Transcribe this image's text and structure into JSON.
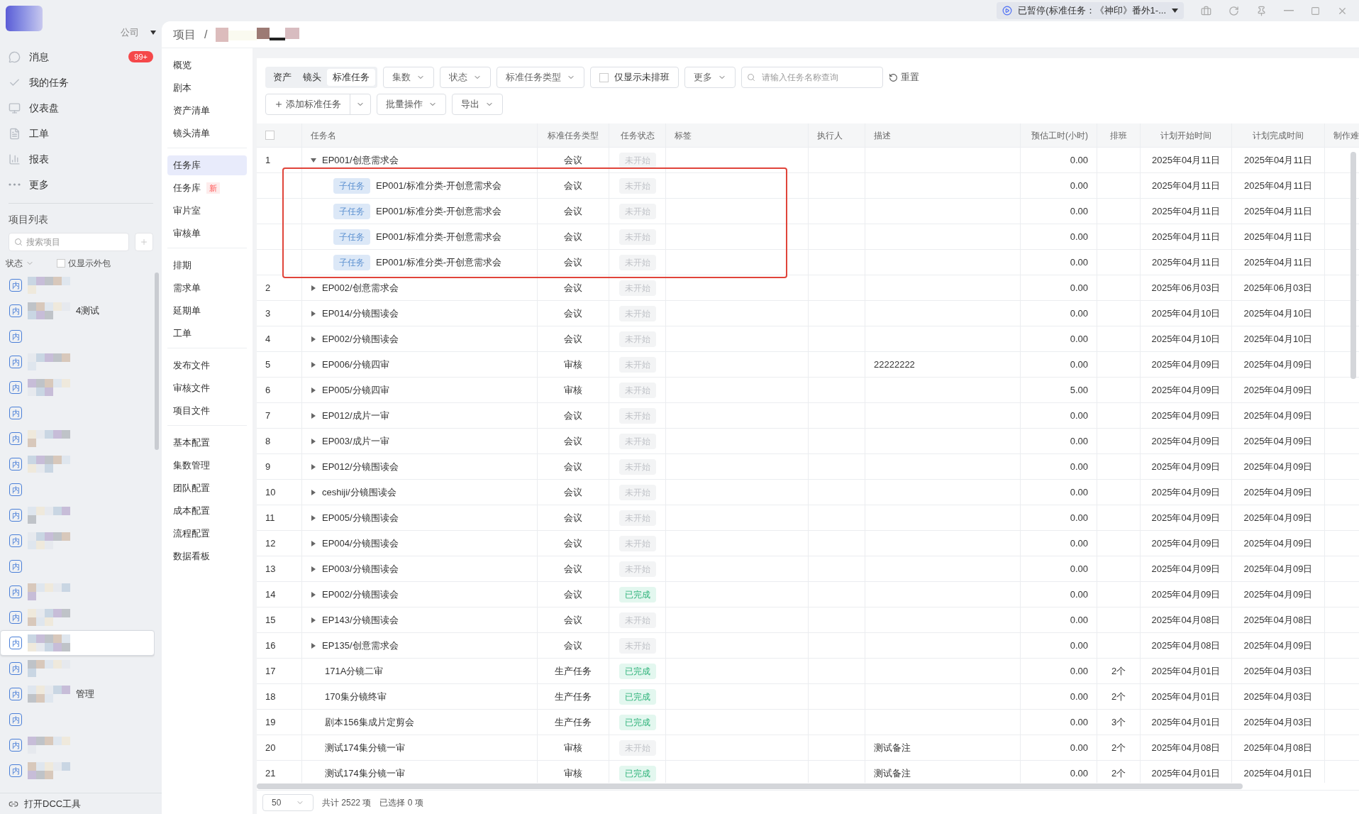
{
  "titlebar": {
    "task_status": "已暂停(标准任务：《神印》番外1-..."
  },
  "company": "公司",
  "nav": [
    {
      "label": "消息",
      "badge": "99+"
    },
    {
      "label": "我的任务"
    },
    {
      "label": "仪表盘"
    },
    {
      "label": "工单"
    },
    {
      "label": "报表"
    },
    {
      "label": "更多"
    }
  ],
  "project_list": {
    "title": "项目列表",
    "search_placeholder": "搜索项目",
    "filter": "状态",
    "outsourced_only": {
      "label": "仅显示外包",
      "checked": false
    },
    "items": [
      {
        "badge": "内",
        "selected": false
      },
      {
        "badge": "内",
        "name": "4测试",
        "selected": false
      },
      {
        "badge": "内",
        "selected": false
      },
      {
        "badge": "内",
        "selected": false
      },
      {
        "badge": "内",
        "selected": false
      },
      {
        "badge": "内",
        "selected": false
      },
      {
        "badge": "内",
        "selected": false
      },
      {
        "badge": "内",
        "selected": false
      },
      {
        "badge": "内",
        "selected": false
      },
      {
        "badge": "内",
        "selected": false
      },
      {
        "badge": "内",
        "selected": false
      },
      {
        "badge": "内",
        "selected": false
      },
      {
        "badge": "内",
        "selected": false
      },
      {
        "badge": "内",
        "selected": false
      },
      {
        "badge": "内",
        "selected": true
      },
      {
        "badge": "内",
        "selected": false
      },
      {
        "badge": "内",
        "name": "管理",
        "selected": false
      },
      {
        "badge": "内",
        "selected": false
      },
      {
        "badge": "内",
        "selected": false
      },
      {
        "badge": "内",
        "selected": false
      }
    ]
  },
  "dcc_tool": "打开DCC工具",
  "breadcrumb": {
    "root": "项目",
    "separator": "/"
  },
  "subnav": [
    [
      {
        "label": "概览",
        "selected": false
      },
      {
        "label": "剧本",
        "selected": false
      },
      {
        "label": "资产清单",
        "selected": false
      },
      {
        "label": "镜头清单",
        "selected": false
      }
    ],
    [
      {
        "label": "任务库",
        "selected": true
      },
      {
        "label": "任务库",
        "badge": "新",
        "selected": false
      },
      {
        "label": "审片室",
        "selected": false
      },
      {
        "label": "审核单",
        "selected": false
      }
    ],
    [
      {
        "label": "排期",
        "selected": false
      },
      {
        "label": "需求单",
        "selected": false
      },
      {
        "label": "延期单",
        "selected": false
      },
      {
        "label": "工单",
        "selected": false
      }
    ],
    [
      {
        "label": "发布文件",
        "selected": false
      },
      {
        "label": "审核文件",
        "selected": false
      },
      {
        "label": "项目文件",
        "selected": false
      }
    ],
    [
      {
        "label": "基本配置",
        "selected": false
      },
      {
        "label": "集数管理",
        "selected": false
      },
      {
        "label": "团队配置",
        "selected": false
      },
      {
        "label": "成本配置",
        "selected": false
      },
      {
        "label": "流程配置",
        "selected": false
      },
      {
        "label": "数据看板",
        "selected": false
      }
    ]
  ],
  "view_tabs": [
    {
      "label": "资产",
      "selected": false
    },
    {
      "label": "镜头",
      "selected": false
    },
    {
      "label": "标准任务",
      "selected": true
    }
  ],
  "filters": [
    "集数",
    "状态",
    "标准任务类型"
  ],
  "unscheduled_only": {
    "label": "仅显示未排班",
    "checked": false
  },
  "more": "更多",
  "search": {
    "placeholder": "请输入任务名称查询"
  },
  "reset": "重置",
  "actions": {
    "add": "添加标准任务",
    "batch": "批量操作",
    "export": "导出"
  },
  "table": {
    "all_selected": false,
    "columns": [
      "任务名",
      "标准任务类型",
      "任务状态",
      "标签",
      "执行人",
      "描述",
      "预估工时(小时)",
      "排班",
      "计划开始时间",
      "计划完成时间",
      "制作难"
    ],
    "rows": [
      {
        "index": "1",
        "name": "EP001/创意需求会",
        "expandable": true,
        "expanded": true,
        "children_framed": true,
        "type": "会议",
        "status": "未开始",
        "completed": false,
        "hours": "0.00",
        "start": "2025年04月11日",
        "end": "2025年04月11日",
        "children": [
          {
            "tag": "子任务",
            "name": "EP001/标准分类-开创意需求会",
            "type": "会议",
            "status": "未开始",
            "completed": false,
            "hours": "0.00",
            "start": "2025年04月11日",
            "end": "2025年04月11日"
          },
          {
            "tag": "子任务",
            "name": "EP001/标准分类-开创意需求会",
            "type": "会议",
            "status": "未开始",
            "completed": false,
            "hours": "0.00",
            "start": "2025年04月11日",
            "end": "2025年04月11日"
          },
          {
            "tag": "子任务",
            "name": "EP001/标准分类-开创意需求会",
            "type": "会议",
            "status": "未开始",
            "completed": false,
            "hours": "0.00",
            "start": "2025年04月11日",
            "end": "2025年04月11日"
          },
          {
            "tag": "子任务",
            "name": "EP001/标准分类-开创意需求会",
            "type": "会议",
            "status": "未开始",
            "completed": false,
            "hours": "0.00",
            "start": "2025年04月11日",
            "end": "2025年04月11日"
          }
        ]
      },
      {
        "index": "2",
        "name": "EP002/创意需求会",
        "expandable": true,
        "expanded": false,
        "type": "会议",
        "status": "未开始",
        "completed": false,
        "hours": "0.00",
        "start": "2025年06月03日",
        "end": "2025年06月03日"
      },
      {
        "index": "3",
        "name": "EP014/分镜围读会",
        "expandable": true,
        "expanded": false,
        "type": "会议",
        "status": "未开始",
        "completed": false,
        "hours": "0.00",
        "start": "2025年04月10日",
        "end": "2025年04月10日"
      },
      {
        "index": "4",
        "name": "EP002/分镜围读会",
        "expandable": true,
        "expanded": false,
        "type": "会议",
        "status": "未开始",
        "completed": false,
        "hours": "0.00",
        "start": "2025年04月10日",
        "end": "2025年04月10日"
      },
      {
        "index": "5",
        "name": "EP006/分镜四审",
        "expandable": true,
        "expanded": false,
        "type": "审核",
        "status": "未开始",
        "completed": false,
        "description": "22222222",
        "hours": "0.00",
        "start": "2025年04月09日",
        "end": "2025年04月09日"
      },
      {
        "index": "6",
        "name": "EP005/分镜四审",
        "expandable": true,
        "expanded": false,
        "type": "审核",
        "status": "未开始",
        "completed": false,
        "hours": "5.00",
        "start": "2025年04月09日",
        "end": "2025年04月09日"
      },
      {
        "index": "7",
        "name": "EP012/成片一审",
        "expandable": true,
        "expanded": false,
        "type": "会议",
        "status": "未开始",
        "completed": false,
        "hours": "0.00",
        "start": "2025年04月09日",
        "end": "2025年04月09日"
      },
      {
        "index": "8",
        "name": "EP003/成片一审",
        "expandable": true,
        "expanded": false,
        "type": "会议",
        "status": "未开始",
        "completed": false,
        "hours": "0.00",
        "start": "2025年04月09日",
        "end": "2025年04月09日"
      },
      {
        "index": "9",
        "name": "EP012/分镜围读会",
        "expandable": true,
        "expanded": false,
        "type": "会议",
        "status": "未开始",
        "completed": false,
        "hours": "0.00",
        "start": "2025年04月09日",
        "end": "2025年04月09日"
      },
      {
        "index": "10",
        "name": "ceshiji/分镜围读会",
        "expandable": true,
        "expanded": false,
        "type": "会议",
        "status": "未开始",
        "completed": false,
        "hours": "0.00",
        "start": "2025年04月09日",
        "end": "2025年04月09日"
      },
      {
        "index": "11",
        "name": "EP005/分镜围读会",
        "expandable": true,
        "expanded": false,
        "type": "会议",
        "status": "未开始",
        "completed": false,
        "hours": "0.00",
        "start": "2025年04月09日",
        "end": "2025年04月09日"
      },
      {
        "index": "12",
        "name": "EP004/分镜围读会",
        "expandable": true,
        "expanded": false,
        "type": "会议",
        "status": "未开始",
        "completed": false,
        "hours": "0.00",
        "start": "2025年04月09日",
        "end": "2025年04月09日"
      },
      {
        "index": "13",
        "name": "EP003/分镜围读会",
        "expandable": true,
        "expanded": false,
        "type": "会议",
        "status": "未开始",
        "completed": false,
        "hours": "0.00",
        "start": "2025年04月09日",
        "end": "2025年04月09日"
      },
      {
        "index": "14",
        "name": "EP002/分镜围读会",
        "expandable": true,
        "expanded": false,
        "type": "会议",
        "status": "已完成",
        "completed": true,
        "hours": "0.00",
        "start": "2025年04月09日",
        "end": "2025年04月09日"
      },
      {
        "index": "15",
        "name": "EP143/分镜围读会",
        "expandable": true,
        "expanded": false,
        "type": "会议",
        "status": "未开始",
        "completed": false,
        "hours": "0.00",
        "start": "2025年04月08日",
        "end": "2025年04月08日"
      },
      {
        "index": "16",
        "name": "EP135/创意需求会",
        "expandable": true,
        "expanded": false,
        "type": "会议",
        "status": "未开始",
        "completed": false,
        "hours": "0.00",
        "start": "2025年04月08日",
        "end": "2025年04月09日"
      },
      {
        "index": "17",
        "name": "171A分镜二审",
        "expandable": false,
        "type": "生产任务",
        "status": "已完成",
        "completed": true,
        "hours": "0.00",
        "schedule": "2个",
        "start": "2025年04月01日",
        "end": "2025年04月03日"
      },
      {
        "index": "18",
        "name": "170集分镜终审",
        "expandable": false,
        "type": "生产任务",
        "status": "已完成",
        "completed": true,
        "hours": "0.00",
        "schedule": "2个",
        "start": "2025年04月01日",
        "end": "2025年04月03日"
      },
      {
        "index": "19",
        "name": "剧本156集成片定剪会",
        "expandable": false,
        "type": "生产任务",
        "status": "已完成",
        "completed": true,
        "hours": "0.00",
        "schedule": "3个",
        "start": "2025年04月01日",
        "end": "2025年04月03日"
      },
      {
        "index": "20",
        "name": "测试174集分镜一审",
        "expandable": false,
        "type": "审核",
        "status": "未开始",
        "completed": false,
        "description": "测试备注",
        "hours": "0.00",
        "schedule": "2个",
        "start": "2025年04月08日",
        "end": "2025年04月08日"
      },
      {
        "index": "21",
        "name": "测试174集分镜一审",
        "expandable": false,
        "type": "审核",
        "status": "已完成",
        "completed": true,
        "description": "测试备注",
        "hours": "0.00",
        "schedule": "2个",
        "start": "2025年04月01日",
        "end": "2025年04月01日"
      }
    ]
  },
  "footer": {
    "page_size": "50",
    "total": "共计 2522 项",
    "selected": "已选择 0 项"
  }
}
